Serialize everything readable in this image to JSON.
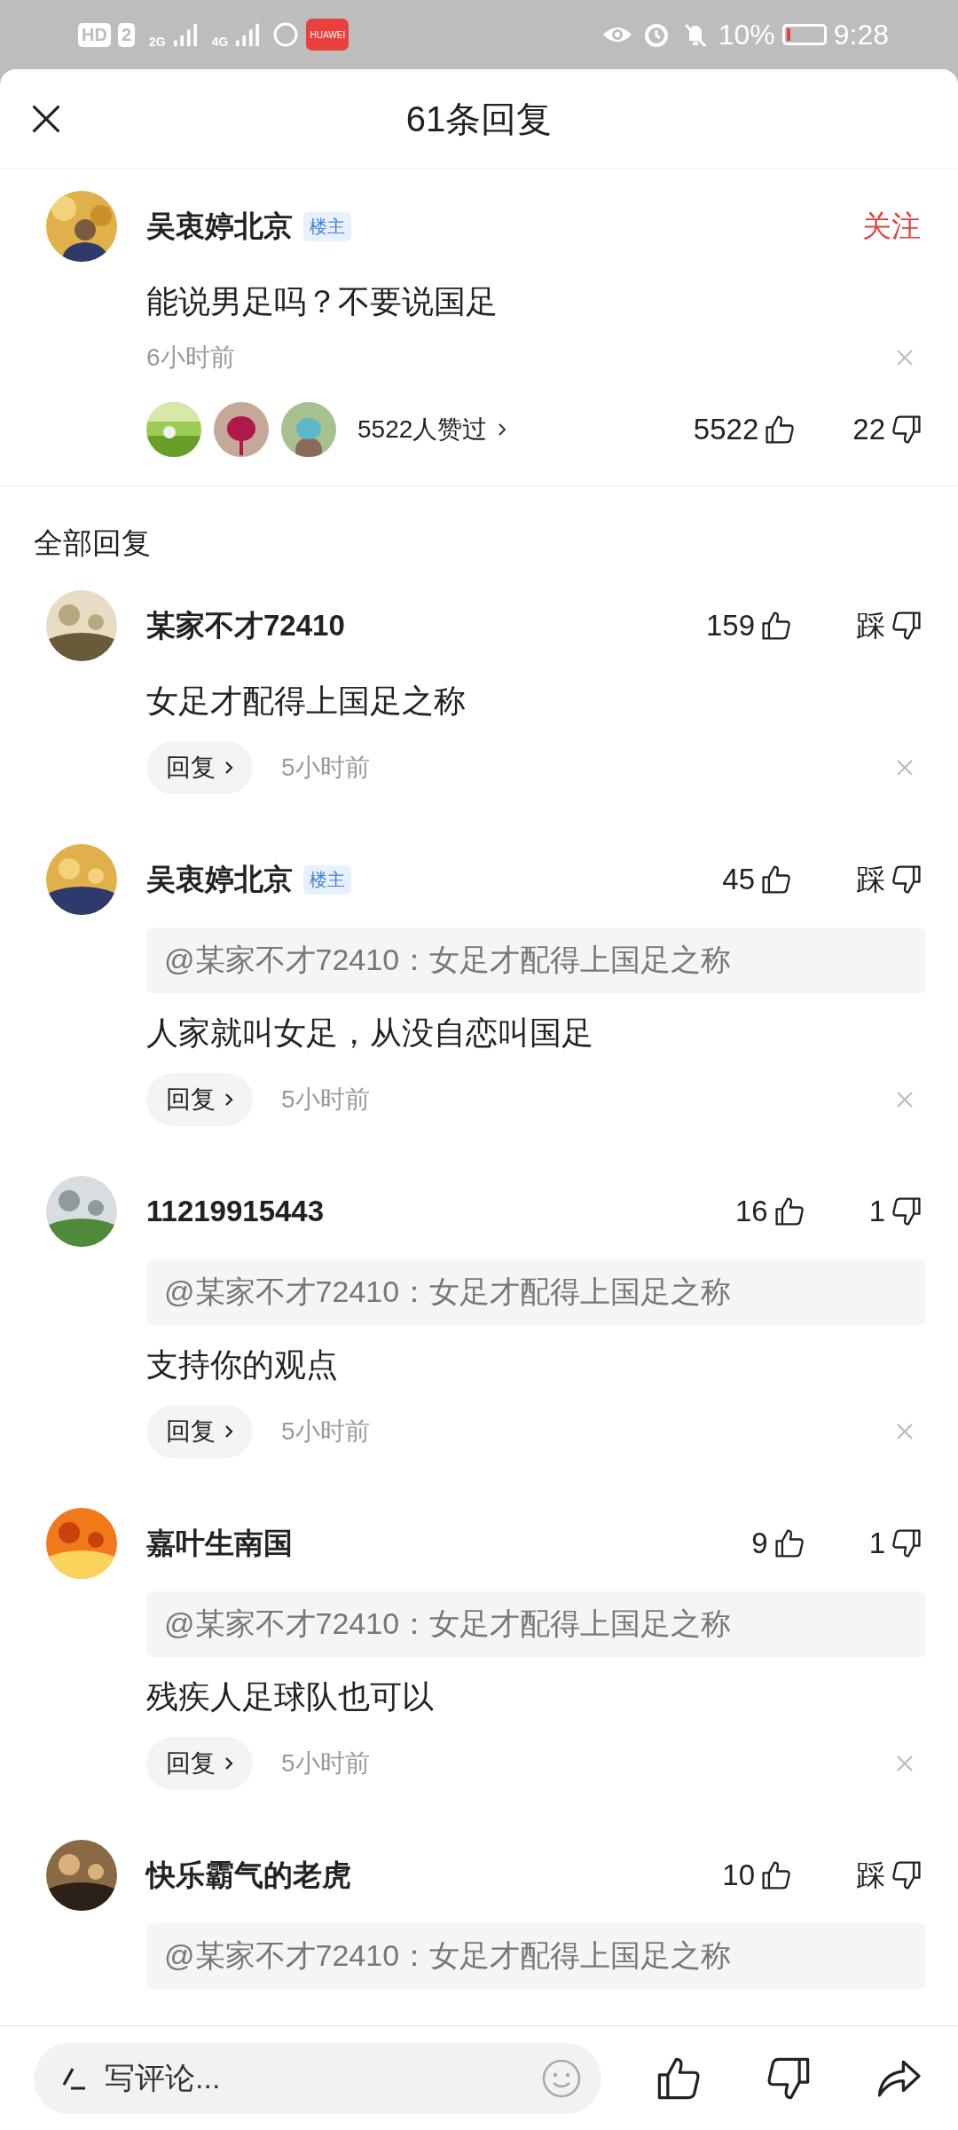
{
  "status_bar": {
    "sim_badges": [
      "HD",
      "2"
    ],
    "networks": [
      "2G",
      "4G"
    ],
    "app_icon_label": "HUAWEI",
    "battery": "10%",
    "time": "9:28"
  },
  "header": {
    "title": "61条回复"
  },
  "main_comment": {
    "name": "吴衷婷北京",
    "badge": "楼主",
    "follow": "关注",
    "text": "能说男足吗？不要说国足",
    "time": "6小时前",
    "likers_text": "5522人赞过",
    "likes": "5522",
    "dislikes": "22"
  },
  "section_title": "全部回复",
  "replies": [
    {
      "name": "某家不才72410",
      "likes": "159",
      "dislike": "踩",
      "text": "女足才配得上国足之称",
      "reply_label": "回复",
      "time": "5小时前"
    },
    {
      "name": "吴衷婷北京",
      "badge": "楼主",
      "likes": "45",
      "dislike": "踩",
      "quote": "@某家不才72410：女足才配得上国足之称",
      "text": "人家就叫女足，从没自恋叫国足",
      "reply_label": "回复",
      "time": "5小时前"
    },
    {
      "name": "11219915443",
      "likes": "16",
      "dislike": "1",
      "quote": "@某家不才72410：女足才配得上国足之称",
      "text": "支持你的观点",
      "reply_label": "回复",
      "time": "5小时前"
    },
    {
      "name": "嘉叶生南国",
      "likes": "9",
      "dislike": "1",
      "quote": "@某家不才72410：女足才配得上国足之称",
      "text": "残疾人足球队也可以",
      "reply_label": "回复",
      "time": "5小时前"
    },
    {
      "name": "快乐霸气的老虎",
      "likes": "10",
      "dislike": "踩",
      "quote": "@某家不才72410：女足才配得上国足之称"
    }
  ],
  "composer": {
    "placeholder": "写评论..."
  }
}
